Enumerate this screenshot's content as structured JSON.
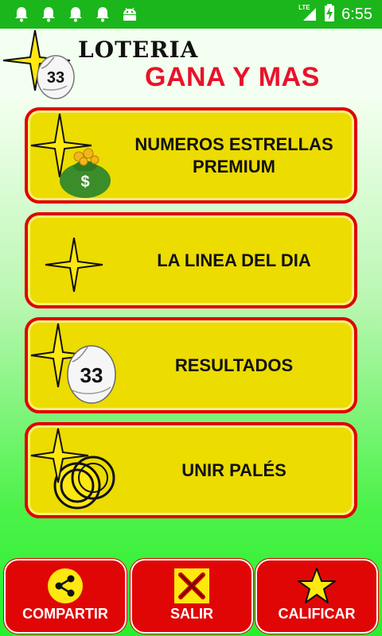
{
  "status_bar": {
    "time": "6:55",
    "network": "LTE",
    "notification_icons": [
      "bell-icon",
      "bell-icon",
      "bell-icon",
      "bell-icon",
      "android-icon"
    ],
    "background_color": "#1bb61b"
  },
  "header": {
    "title_line1": "LOTERIA",
    "title_line2": "GANA Y MAS",
    "ball_number": "33",
    "title2_color": "#e8122a"
  },
  "menu": {
    "items": [
      {
        "label": "NUMEROS ESTRELLAS PREMIUM",
        "icon": "star-money-bag-icon"
      },
      {
        "label": "LA LINEA DEL DIA",
        "icon": "star-icon"
      },
      {
        "label": "RESULTADOS",
        "icon": "star-lottery-ball-icon",
        "ball_number": "33"
      },
      {
        "label": "UNIR PALÉS",
        "icon": "star-rings-icon"
      }
    ],
    "button_color": "#ecdc00",
    "border_color": "#e10000"
  },
  "bottom_bar": {
    "share_label": "COMPARTIR",
    "exit_label": "SALIR",
    "rate_label": "CALIFICAR",
    "button_color": "#e00606"
  }
}
